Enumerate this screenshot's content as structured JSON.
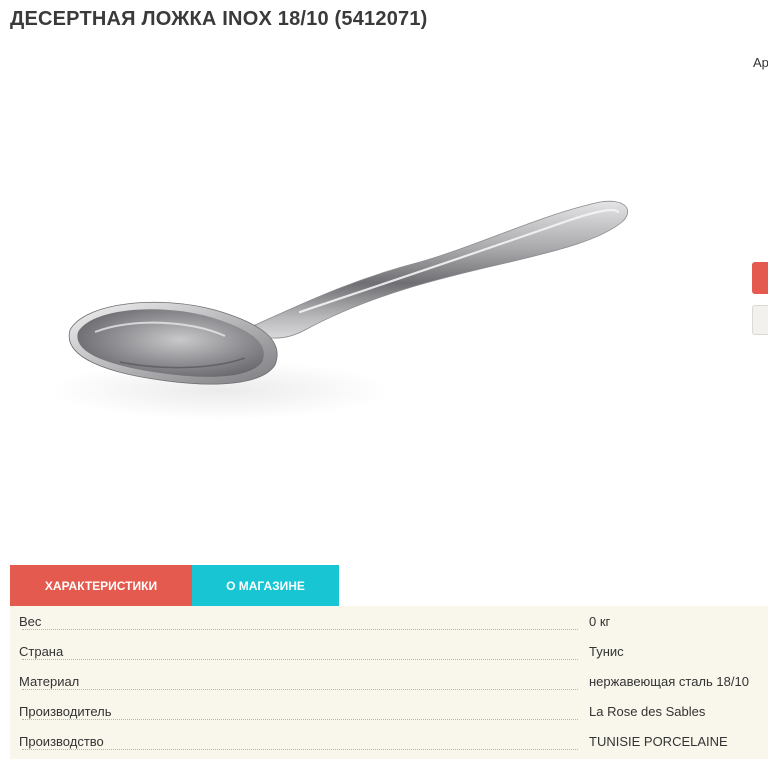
{
  "product": {
    "title": "ДЕСЕРТНАЯ ЛОЖКА INOX 18/10 (5412071)",
    "article_label": "Ар"
  },
  "image": {
    "subject": "spoon-icon"
  },
  "tabs": [
    {
      "label": "ХАРАКТЕРИСТИКИ",
      "active": true,
      "color": "#e55a4e"
    },
    {
      "label": "О МАГАЗИНЕ",
      "active": false,
      "color": "#17c5d3"
    }
  ],
  "specs": [
    {
      "name": "Вес",
      "value": "0 кг"
    },
    {
      "name": "Страна",
      "value": "Тунис"
    },
    {
      "name": "Материал",
      "value": "нержавеющая сталь 18/10"
    },
    {
      "name": "Производитель",
      "value": "La Rose des Sables"
    },
    {
      "name": "Производство",
      "value": "TUNISIE PORCELAINE"
    }
  ],
  "colors": {
    "accent_red": "#e55a4e",
    "accent_cyan": "#17c5d3",
    "specs_background": "#f9f6ec"
  }
}
